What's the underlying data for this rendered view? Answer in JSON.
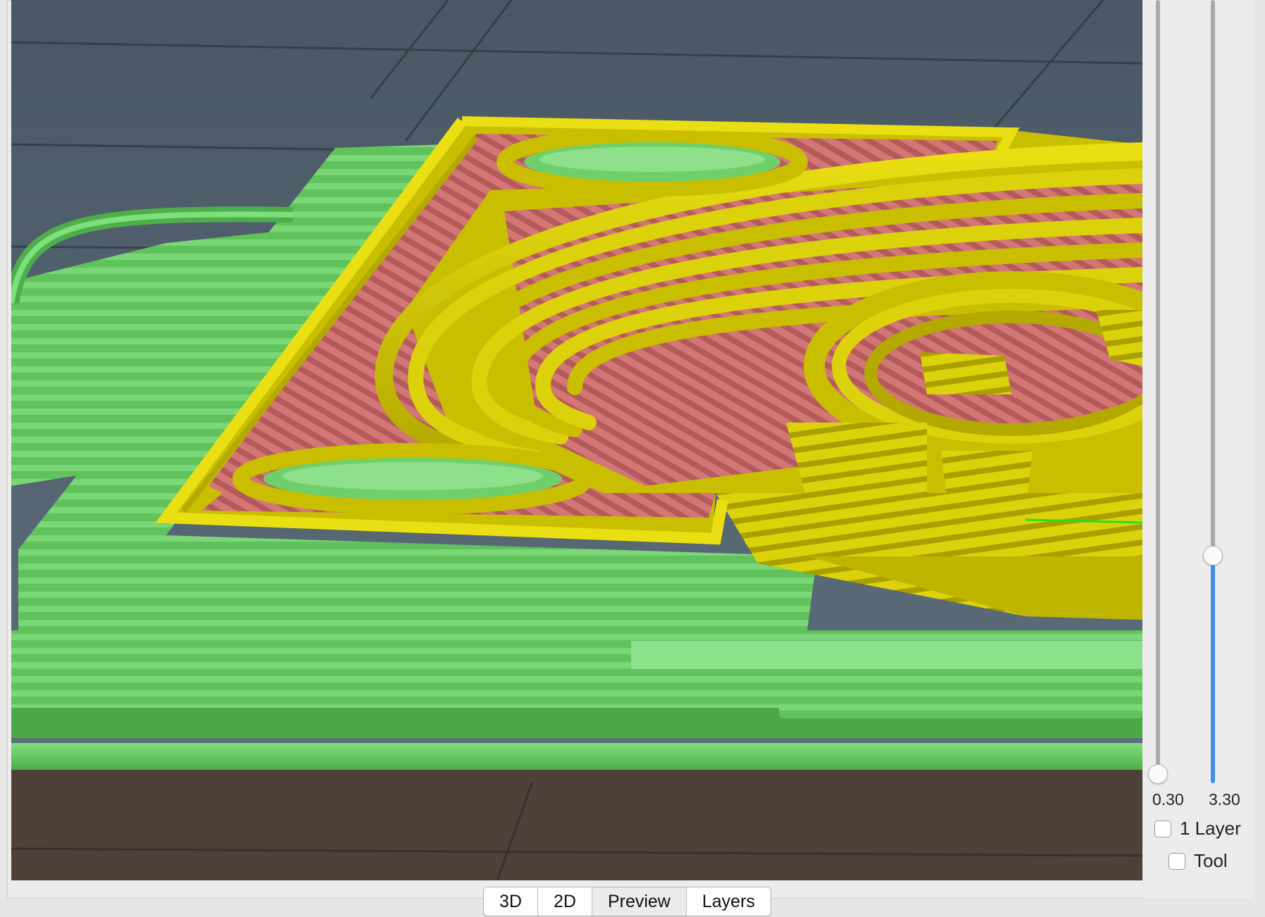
{
  "layer_slider": {
    "low_value": "0.30",
    "high_value": "3.30",
    "high_position_fraction": 0.71,
    "low_position_fraction": 0.0,
    "active_color": "#3d8ef0"
  },
  "options": {
    "one_layer_label": "1 Layer",
    "one_layer_checked": false,
    "tool_label": "Tool",
    "tool_checked": false
  },
  "view_tabs": [
    {
      "label": "3D"
    },
    {
      "label": "2D"
    },
    {
      "label": "Preview"
    },
    {
      "label": "Layers"
    }
  ],
  "active_tab": "Preview",
  "render_colors": {
    "perimeter": "#d4cb00",
    "infill": "#c96a6a",
    "support": "#6fcf6a",
    "bed_grid": "#4c5a66",
    "bed_base": "#4f4039"
  }
}
